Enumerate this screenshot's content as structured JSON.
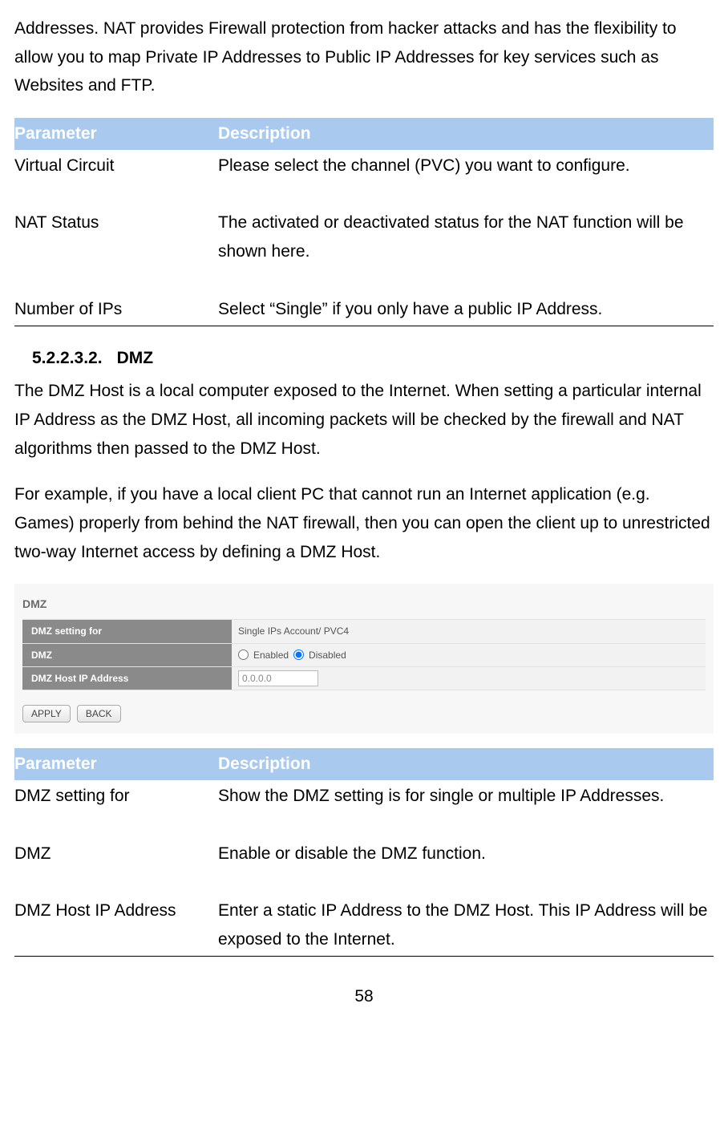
{
  "intro_paragraph": "Addresses. NAT provides Firewall protection from hacker attacks and has the flexibility to allow you to map Private IP Addresses to Public IP Addresses for key services such as Websites and FTP.",
  "table1": {
    "header_param": "Parameter",
    "header_desc": "Description",
    "rows": [
      {
        "param": "Virtual Circuit",
        "desc": "Please select the channel (PVC) you want to configure."
      },
      {
        "param": "NAT Status",
        "desc": "The activated or deactivated status for the NAT function will be shown here."
      },
      {
        "param": "Number of IPs",
        "desc": "Select “Single” if you only have a public IP Address."
      }
    ]
  },
  "section": {
    "number": "5.2.2.3.2.",
    "title": "DMZ"
  },
  "dmz_para1": "The DMZ Host is a local computer exposed to the Internet. When setting a particular internal IP Address as the DMZ Host, all incoming packets will be checked by the firewall and NAT algorithms then passed to the DMZ Host.",
  "dmz_para2": "For example, if you have a local client PC that cannot run an Internet application (e.g. Games) properly from behind the NAT firewall, then you can open the client up to unrestricted two-way Internet access by defining a DMZ Host.",
  "ui": {
    "title": "DMZ",
    "row1_label": "DMZ setting for",
    "row1_value": "Single IPs Account/ PVC4",
    "row2_label": "DMZ",
    "radio_enabled": "Enabled",
    "radio_disabled": "Disabled",
    "row3_label": "DMZ Host IP Address",
    "row3_value": "0.0.0.0",
    "btn_apply": "APPLY",
    "btn_back": "BACK"
  },
  "table2": {
    "header_param": "Parameter",
    "header_desc": "Description",
    "rows": [
      {
        "param": "DMZ setting for",
        "desc": "Show the DMZ setting is for single or multiple IP Addresses."
      },
      {
        "param": "DMZ",
        "desc": "Enable or disable the DMZ function."
      },
      {
        "param": "DMZ Host IP Address",
        "desc": "Enter a static IP Address to the DMZ Host. This IP Address will be exposed to the Internet."
      }
    ]
  },
  "page_number": "58"
}
